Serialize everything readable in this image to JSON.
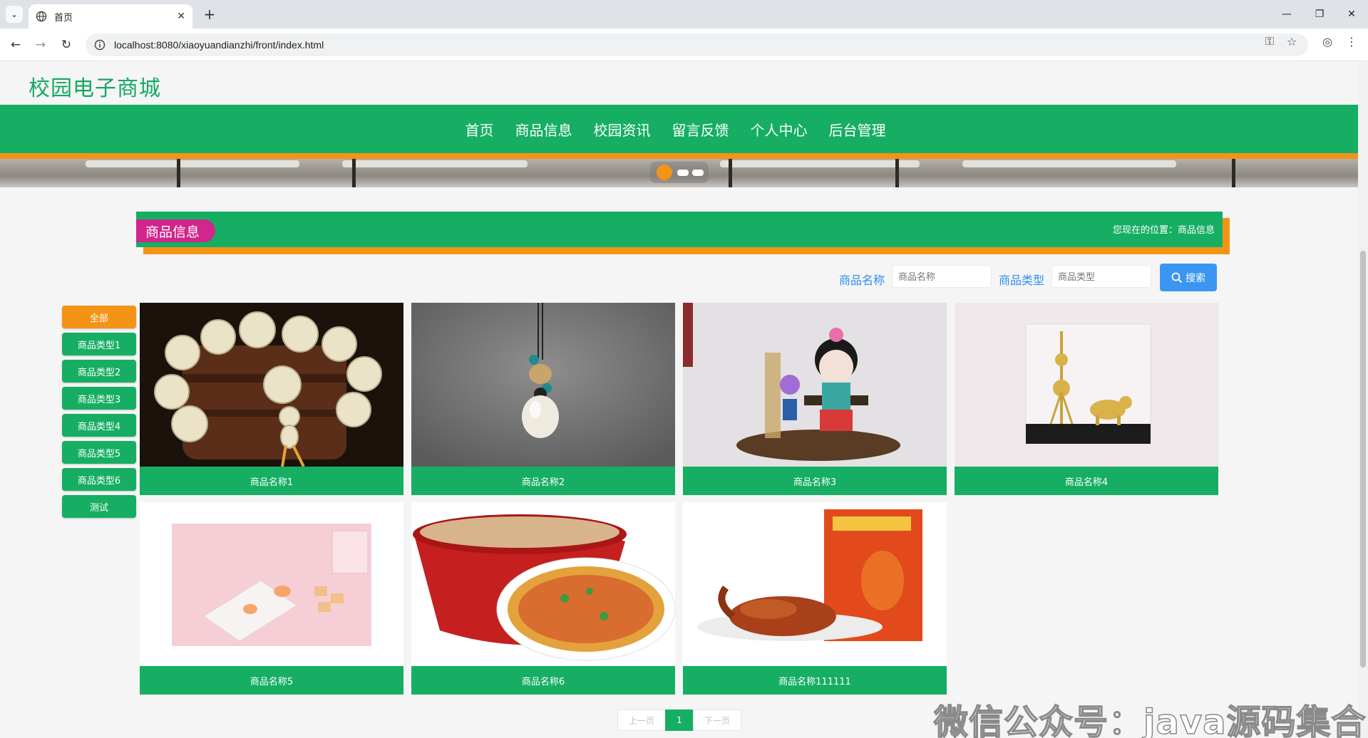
{
  "browser": {
    "tab_title": "首页",
    "url": "localhost:8080/xiaoyuandianzhi/front/index.html"
  },
  "site": {
    "brand": "校园电子商城",
    "nav": [
      "首页",
      "商品信息",
      "校园资讯",
      "留言反馈",
      "个人中心",
      "后台管理"
    ]
  },
  "section": {
    "title": "商品信息",
    "breadcrumb": "您现在的位置：商品信息"
  },
  "search": {
    "name_label": "商品名称",
    "name_placeholder": "商品名称",
    "type_label": "商品类型",
    "type_placeholder": "商品类型",
    "button": "搜索"
  },
  "categories": [
    "全部",
    "商品类型1",
    "商品类型2",
    "商品类型3",
    "商品类型4",
    "商品类型5",
    "商品类型6",
    "测试"
  ],
  "products": [
    {
      "name": "商品名称1",
      "image": "bead-bracelet"
    },
    {
      "name": "商品名称2",
      "image": "gourd-pendant"
    },
    {
      "name": "商品名称3",
      "image": "doll-figurine"
    },
    {
      "name": "商品名称4",
      "image": "tower-model"
    },
    {
      "name": "商品名称5",
      "image": "candy-dish"
    },
    {
      "name": "商品名称6",
      "image": "instant-noodles"
    },
    {
      "name": "商品名称111111",
      "image": "roast-duck"
    }
  ],
  "pagination": {
    "prev": "上一页",
    "current": "1",
    "next": "下一页"
  },
  "watermark": "微信公众号：java源码集合",
  "colors": {
    "primary": "#16ae63",
    "accent": "#f39416",
    "badge": "#d1268b",
    "link": "#2c8ef0"
  }
}
